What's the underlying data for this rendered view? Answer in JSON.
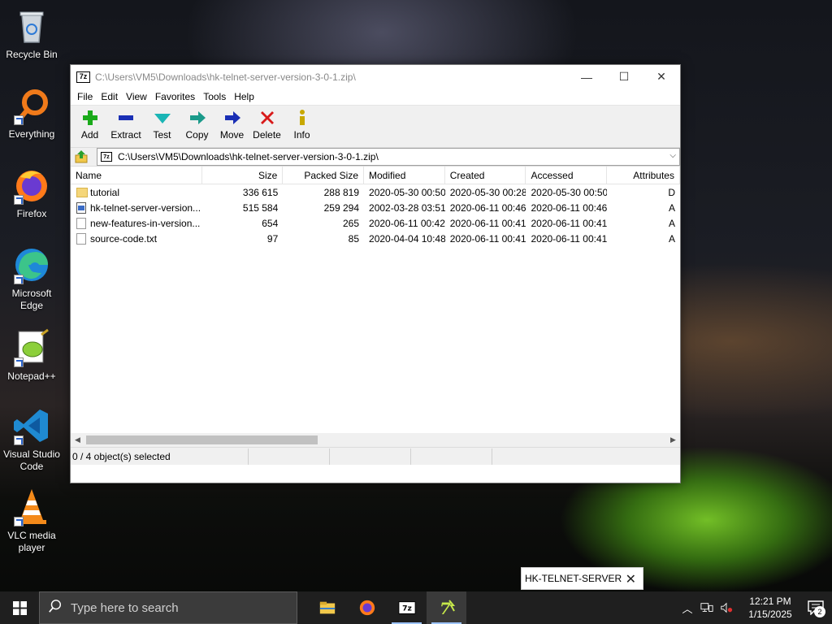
{
  "desktop": {
    "icons": [
      {
        "label": "Recycle Bin"
      },
      {
        "label": "Everything"
      },
      {
        "label": "Firefox"
      },
      {
        "label": "Microsoft Edge"
      },
      {
        "label": "Notepad++"
      },
      {
        "label": "Visual Studio Code"
      },
      {
        "label": "VLC media player"
      }
    ]
  },
  "window": {
    "title": "C:\\Users\\VM5\\Downloads\\hk-telnet-server-version-3-0-1.zip\\",
    "title_icon": "7z",
    "minimize": "—",
    "maximize": "☐",
    "close": "✕"
  },
  "menu": [
    "File",
    "Edit",
    "View",
    "Favorites",
    "Tools",
    "Help"
  ],
  "toolbar": [
    {
      "label": "Add",
      "icon": "plus-icon",
      "color": "#1aaa1a"
    },
    {
      "label": "Extract",
      "icon": "minus-icon",
      "color": "#1a2fb5"
    },
    {
      "label": "Test",
      "icon": "check-arrow-icon",
      "color": "#1ab5b5"
    },
    {
      "label": "Copy",
      "icon": "copy-arrow-icon",
      "color": "#1a9a8a"
    },
    {
      "label": "Move",
      "icon": "move-arrow-icon",
      "color": "#1a2fb5"
    },
    {
      "label": "Delete",
      "icon": "x-icon",
      "color": "#d81a1a"
    },
    {
      "label": "Info",
      "icon": "info-icon",
      "color": "#c8a800"
    }
  ],
  "address": {
    "path": "C:\\Users\\VM5\\Downloads\\hk-telnet-server-version-3-0-1.zip\\"
  },
  "columns": [
    "Name",
    "Size",
    "Packed Size",
    "Modified",
    "Created",
    "Accessed",
    "Attributes"
  ],
  "rows": [
    {
      "name": "tutorial",
      "type": "folder",
      "size": "336 615",
      "packed": "288 819",
      "modified": "2020-05-30 00:50",
      "created": "2020-05-30 00:28",
      "accessed": "2020-05-30 00:50",
      "attr": "D"
    },
    {
      "name": "hk-telnet-server-version...",
      "type": "exe",
      "size": "515 584",
      "packed": "259 294",
      "modified": "2002-03-28 03:51",
      "created": "2020-06-11 00:46",
      "accessed": "2020-06-11 00:46",
      "attr": "A"
    },
    {
      "name": "new-features-in-version...",
      "type": "file",
      "size": "654",
      "packed": "265",
      "modified": "2020-06-11 00:42",
      "created": "2020-06-11 00:41",
      "accessed": "2020-06-11 00:41",
      "attr": "A"
    },
    {
      "name": "source-code.txt",
      "type": "file",
      "size": "97",
      "packed": "85",
      "modified": "2020-04-04 10:48",
      "created": "2020-06-11 00:41",
      "accessed": "2020-06-11 00:41",
      "attr": "A"
    }
  ],
  "status": {
    "selected": "0 / 4 object(s) selected"
  },
  "notification": {
    "text": "HK-TELNET-SERVER"
  },
  "taskbar": {
    "search_placeholder": "Type here to search",
    "time": "12:21 PM",
    "date": "1/15/2025",
    "notif_count": "2"
  }
}
